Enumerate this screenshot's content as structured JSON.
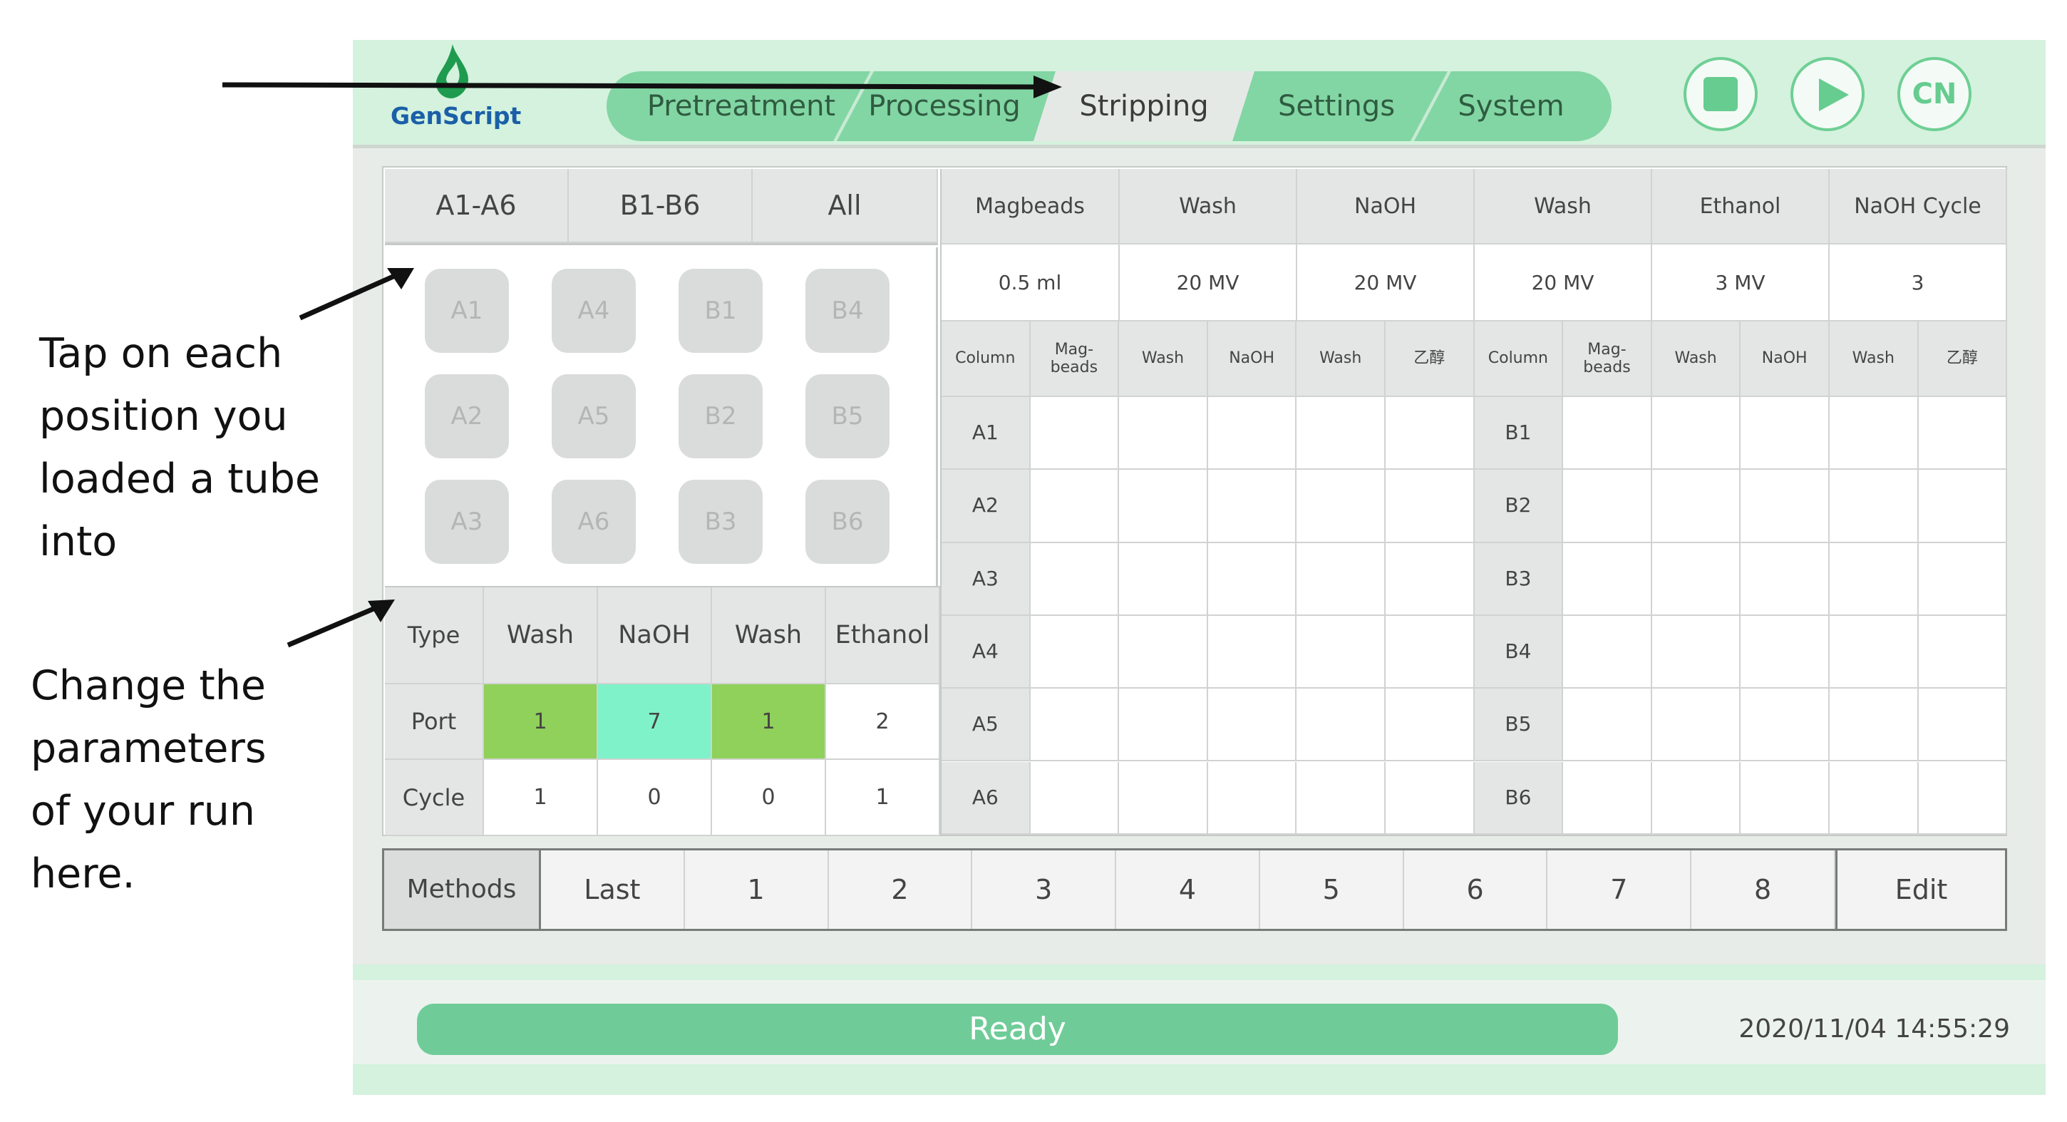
{
  "annotations": {
    "tap_lines": [
      "Tap on each",
      "position you",
      "loaded a tube",
      "into"
    ],
    "change_lines": [
      "Change the",
      "parameters",
      "of your run",
      "here."
    ]
  },
  "app": {
    "logo_text": "GenScript",
    "tabs": [
      "Pretreatment",
      "Processing",
      "Stripping",
      "Settings",
      "System"
    ],
    "active_tab": "Stripping",
    "header_buttons": {
      "stop": "stop-icon",
      "play": "play-icon",
      "lang": "CN"
    }
  },
  "groups": [
    "A1-A6",
    "B1-B6",
    "All"
  ],
  "wells": [
    [
      "A1",
      "A4",
      "B1",
      "B4"
    ],
    [
      "A2",
      "A5",
      "B2",
      "B5"
    ],
    [
      "A3",
      "A6",
      "B3",
      "B6"
    ]
  ],
  "params": {
    "header": [
      "Type",
      "Wash",
      "NaOH",
      "Wash",
      "Ethanol"
    ],
    "port_label": "Port",
    "ports": [
      "1",
      "7",
      "1",
      "2"
    ],
    "port_colors": [
      "#8fd15a",
      "#7ff2c9",
      "#8fd15a",
      "#ffffff"
    ],
    "cycle_label": "Cycle",
    "cycles": [
      "1",
      "0",
      "0",
      "1"
    ]
  },
  "steps": {
    "names": [
      "Magbeads",
      "Wash",
      "NaOH",
      "Wash",
      "Ethanol",
      "NaOH Cycle"
    ],
    "values": [
      "0.5 ml",
      "20 MV",
      "20 MV",
      "20 MV",
      "3 MV",
      "3"
    ]
  },
  "grid": {
    "left_headers": [
      "Column",
      "Mag-\nbeads",
      "Wash",
      "NaOH",
      "Wash",
      "乙醇"
    ],
    "right_headers": [
      "Column",
      "Mag-\nbeads",
      "Wash",
      "NaOH",
      "Wash",
      "乙醇"
    ],
    "left_rows": [
      "A1",
      "A2",
      "A3",
      "A4",
      "A5",
      "A6"
    ],
    "right_rows": [
      "B1",
      "B2",
      "B3",
      "B4",
      "B5",
      "B6"
    ]
  },
  "methods": {
    "label": "Methods",
    "items": [
      "Last",
      "1",
      "2",
      "3",
      "4",
      "5",
      "6",
      "7",
      "8"
    ],
    "edit_label": "Edit"
  },
  "status": {
    "text": "Ready",
    "timestamp": "2020/11/04  14:55:29"
  }
}
